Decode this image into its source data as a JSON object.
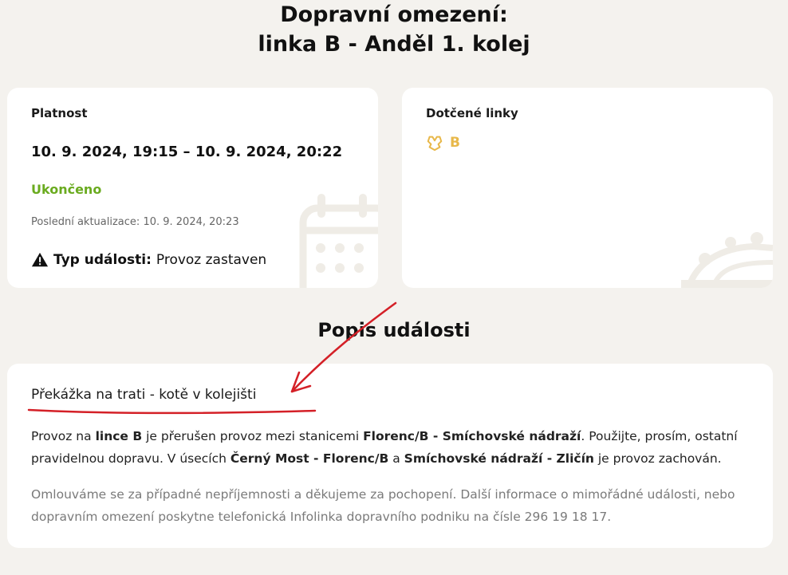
{
  "header": {
    "title_line1": "Dopravní omezení:",
    "title_line2": "linka B - Anděl 1. kolej"
  },
  "validity": {
    "label": "Platnost",
    "range": "10. 9. 2024, 19:15 – 10. 9. 2024, 20:22",
    "status": "Ukončeno",
    "status_color": "#6aab1f",
    "updated_label": "Poslední aktualizace:",
    "updated_value": "10. 9. 2024, 20:23",
    "event_type_label": "Typ události:",
    "event_type_value": "Provoz zastaven",
    "event_icon": "warning-icon",
    "deco_icon": "calendar-icon"
  },
  "affected_lines": {
    "label": "Dotčené linky",
    "lines": [
      {
        "icon": "metro-icon",
        "name": "B",
        "color": "#e8b84a"
      }
    ],
    "deco_icon": "metro-train-icon"
  },
  "description": {
    "section_title": "Popis události",
    "heading": "Překážka na trati - kotě v kolejišti",
    "para_parts": [
      {
        "text": "Provoz na ",
        "bold": false
      },
      {
        "text": "lince B",
        "bold": true
      },
      {
        "text": " je přerušen provoz mezi stanicemi ",
        "bold": false
      },
      {
        "text": "Florenc/B - Smíchovské nádraží",
        "bold": true
      },
      {
        "text": ". Použijte, prosím, ostatní pravidelnou dopravu. V úsecích ",
        "bold": false
      },
      {
        "text": "Černý Most - Florenc/B",
        "bold": true
      },
      {
        "text": " a ",
        "bold": false
      },
      {
        "text": "Smíchovské nádraží - Zličín",
        "bold": true
      },
      {
        "text": " je provoz zachován.",
        "bold": false
      }
    ],
    "note": "Omlouváme se za případné nepříjemnosti a děkujeme za pochopení. Další informace o mimořádné události, nebo dopravním omezení poskytne telefonická Infolinka dopravního podniku na čísle 296 19 18 17."
  },
  "annotation_color": "#d42027"
}
